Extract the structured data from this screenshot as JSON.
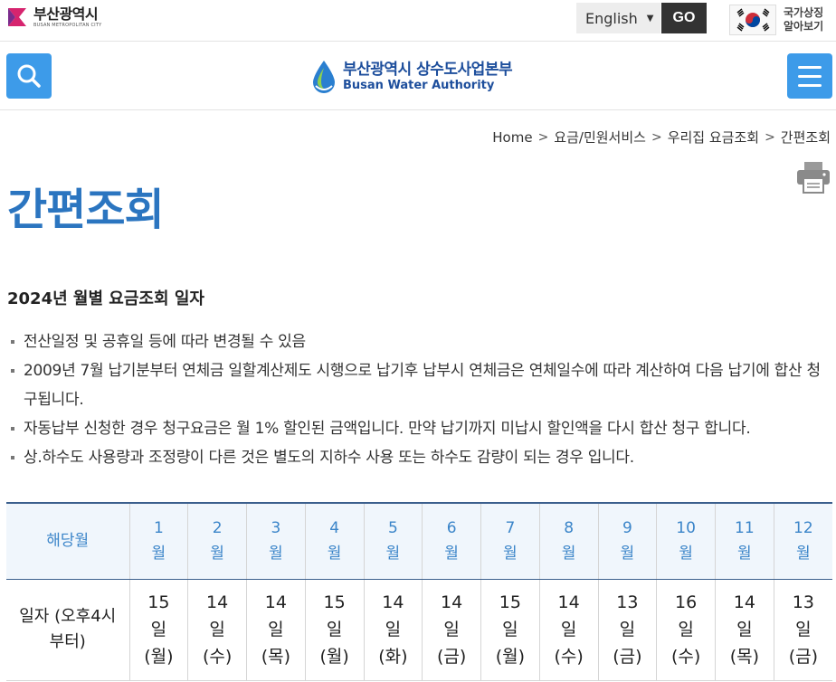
{
  "topbar": {
    "city_name": "부산광역시",
    "city_sub": "BUSAN METROPOLITAN CITY",
    "language": "English",
    "go_label": "GO",
    "national_symbol_label_line1": "국가상징",
    "national_symbol_label_line2": "알아보기"
  },
  "header": {
    "brand_ko": "부산광역시 상수도사업본부",
    "brand_en": "Busan Water Authority",
    "search_icon": "search-icon",
    "menu_icon": "hamburger-menu-icon"
  },
  "breadcrumb": [
    "Home",
    "요금/민원서비스",
    "우리집 요금조회",
    "간편조회"
  ],
  "page_title": "간편조회",
  "section_title": "2024년 월별 요금조회 일자",
  "notes": [
    "전산일정 및 공휴일 등에 따라 변경될 수 있음",
    "2009년 7월 납기분부터 연체금 일할계산제도 시행으로 납기후 납부시 연체금은 연체일수에 따라 계산하여 다음 납기에 합산 청구됩니다.",
    "자동납부 신청한 경우 청구요금은 월 1% 할인된 금액입니다. 만약 납기까지 미납시 할인액을 다시 합산 청구 합니다.",
    "상.하수도 사용량과 조정량이 다른 것은 별도의 지하수 사용 또는 하수도 감량이 되는 경우 입니다."
  ],
  "table": {
    "header_label": "해당월",
    "row_label": "일자 (오후4시부터)",
    "months": [
      {
        "num": "1",
        "unit": "월"
      },
      {
        "num": "2",
        "unit": "월"
      },
      {
        "num": "3",
        "unit": "월"
      },
      {
        "num": "4",
        "unit": "월"
      },
      {
        "num": "5",
        "unit": "월"
      },
      {
        "num": "6",
        "unit": "월"
      },
      {
        "num": "7",
        "unit": "월"
      },
      {
        "num": "8",
        "unit": "월"
      },
      {
        "num": "9",
        "unit": "월"
      },
      {
        "num": "10",
        "unit": "월"
      },
      {
        "num": "11",
        "unit": "월"
      },
      {
        "num": "12",
        "unit": "월"
      }
    ],
    "dates": [
      {
        "day": "15",
        "unit": "일",
        "weekday": "(월)"
      },
      {
        "day": "14",
        "unit": "일",
        "weekday": "(수)"
      },
      {
        "day": "14",
        "unit": "일",
        "weekday": "(목)"
      },
      {
        "day": "15",
        "unit": "일",
        "weekday": "(월)"
      },
      {
        "day": "14",
        "unit": "일",
        "weekday": "(화)"
      },
      {
        "day": "14",
        "unit": "일",
        "weekday": "(금)"
      },
      {
        "day": "15",
        "unit": "일",
        "weekday": "(월)"
      },
      {
        "day": "14",
        "unit": "일",
        "weekday": "(수)"
      },
      {
        "day": "13",
        "unit": "일",
        "weekday": "(금)"
      },
      {
        "day": "16",
        "unit": "일",
        "weekday": "(수)"
      },
      {
        "day": "14",
        "unit": "일",
        "weekday": "(목)"
      },
      {
        "day": "13",
        "unit": "일",
        "weekday": "(금)"
      }
    ]
  },
  "colors": {
    "accent_blue": "#3d9be9",
    "title_blue": "#2b75c0",
    "brand_navy": "#1d4e9c",
    "table_header_bg": "#f0f6fc",
    "table_header_text": "#3b85c9"
  }
}
